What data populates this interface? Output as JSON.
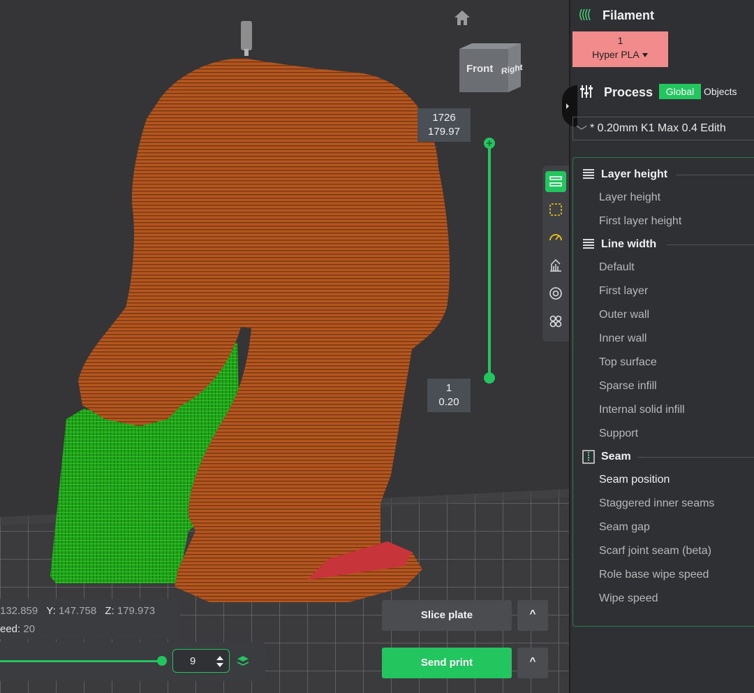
{
  "viewport": {
    "view_cube": {
      "front": "Front",
      "right": "Right"
    },
    "layer_top": {
      "layer": "1726",
      "height": "179.97"
    },
    "layer_bottom": {
      "layer": "1",
      "height": "0.20"
    },
    "coords": {
      "x_value": "132.859",
      "y_label": "Y:",
      "y_value": "147.758",
      "z_label": "Z:",
      "z_value": "179.973",
      "speed_label": "eed:",
      "speed_value": "20"
    },
    "move_slider": {
      "value": "9"
    },
    "buttons": {
      "slice": "Slice plate",
      "send": "Send print",
      "caret": "^"
    },
    "toolbar_icons": [
      "layers-view-icon",
      "frame-icon",
      "speed-gauge-icon",
      "support-icon",
      "filament-spool-icon",
      "multi-part-icon"
    ],
    "colors": {
      "accent": "#22c55e",
      "model": "#b4561f",
      "support": "#22a41b",
      "seam": "#c7343a"
    }
  },
  "sidebar": {
    "filament": {
      "title": "Filament",
      "slot": "1",
      "name": "Hyper PLA",
      "chip_color": "#f28b8b"
    },
    "process": {
      "title": "Process",
      "global": "Global",
      "objects": "Objects",
      "profile": "* 0.20mm K1 Max 0.4 Edith",
      "expand_glyph": "﹀"
    },
    "groups": [
      {
        "title": "Layer height",
        "items": [
          "Layer height",
          "First layer height"
        ]
      },
      {
        "title": "Line width",
        "items": [
          "Default",
          "First layer",
          "Outer wall",
          "Inner wall",
          "Top surface",
          "Sparse infill",
          "Internal solid infill",
          "Support"
        ]
      },
      {
        "title": "Seam",
        "items": [
          "Seam position",
          "Staggered inner seams",
          "Seam gap",
          "Scarf joint seam (beta)",
          "Role base wipe speed",
          "Wipe speed"
        ]
      }
    ],
    "highlighted_item": "Seam position"
  }
}
